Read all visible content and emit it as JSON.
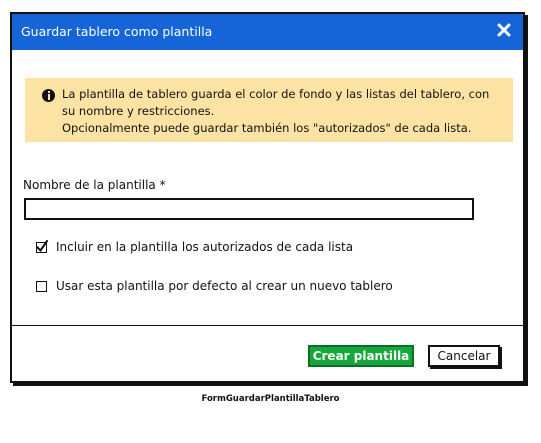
{
  "dialog": {
    "title": "Guardar tablero como plantilla",
    "close_icon": "close-icon",
    "info": {
      "icon": "info-circle-icon",
      "line1": "La plantilla de tablero guarda el color de fondo y las listas del tablero, con",
      "line2": "su nombre y restricciones.",
      "line3": "Opcionalmente puede guardar también los \"autorizados\" de cada lista."
    },
    "name_label": "Nombre de la plantilla *",
    "name_value": "",
    "checkbox_authorized": {
      "label": "Incluir en la plantilla los autorizados de cada lista",
      "checked": true
    },
    "checkbox_default": {
      "label": "Usar esta plantilla por defecto al crear un nuevo tablero",
      "checked": false
    },
    "create_button": "Crear plantilla",
    "cancel_button": "Cancelar"
  },
  "caption": "FormGuardarPlantillaTablero",
  "colors": {
    "titlebar": "#1565d8",
    "info_bg": "#fce3a4",
    "primary_button": "#16a83b"
  }
}
